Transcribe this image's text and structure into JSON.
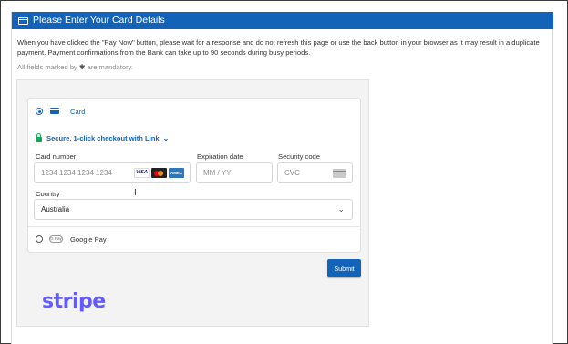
{
  "header": {
    "title": "Please Enter Your Card Details",
    "icon": "credit-card-icon"
  },
  "notice": "When you have clicked the \"Pay Now\" button, please wait for a response and do not refresh this page or use the back button in your browser as it may result in a duplicate payment. Payment confirmations from the Bank can take up to 90 seconds during busy periods.",
  "mandatory": {
    "prefix": "All fields marked by",
    "star": "✱",
    "suffix": "are mandatory."
  },
  "payment": {
    "card_option_label": "Card",
    "link_label": "Secure, 1-click checkout with Link",
    "card_number": {
      "label": "Card number",
      "placeholder": "1234 1234 1234 1234",
      "brands": [
        "VISA",
        "Mastercard",
        "AMEX"
      ]
    },
    "expiration": {
      "label": "Expiration date",
      "placeholder": "MM / YY"
    },
    "security": {
      "label": "Security code",
      "placeholder": "CVC"
    },
    "country": {
      "label": "Country",
      "value": "Australia"
    },
    "gpay_label": "Google Pay",
    "gpay_badge": "G Pay"
  },
  "submit_label": "Submit",
  "stripe_logo": "stripe",
  "colors": {
    "accent": "#1364b8",
    "link_green": "#19a55a",
    "stripe": "#635bff"
  }
}
